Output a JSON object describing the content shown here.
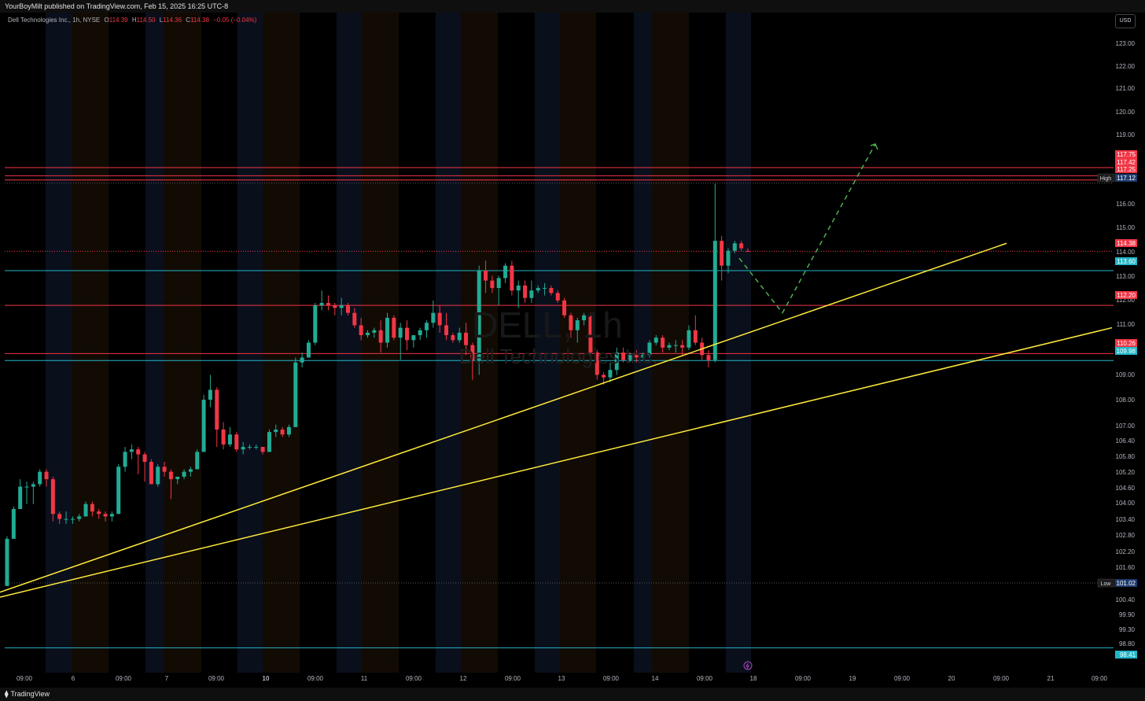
{
  "header": {
    "published": "YourBoyMilt published on TradingView.com, Feb 15, 2025 16:25 UTC-8"
  },
  "legend": {
    "symbol": "Dell Technologies Inc., 1h, NYSE",
    "o_label": "O",
    "o_value": "114.39",
    "h_label": "H",
    "h_value": "114.50",
    "l_label": "L",
    "l_value": "114.36",
    "c_label": "C",
    "c_value": "114.38",
    "change": "−0.05 (−0.04%)"
  },
  "currency": "USD",
  "watermark": {
    "ticker": "DELL, 1h",
    "name": "Dell Technologies Inc."
  },
  "footer": {
    "brand": "TradingView"
  },
  "colors": {
    "up": "#22ab94",
    "down": "#f23645",
    "trend": "#ffeb3b",
    "projection": "#4caf50",
    "resistance": "#f23645",
    "support": "#22b5c7"
  },
  "chart_data": {
    "type": "candlestick",
    "ylim": [
      97.9,
      123.5
    ],
    "y_ticks": [
      "123.00",
      "122.00",
      "121.00",
      "120.00",
      "119.00",
      "118.00",
      "116.00",
      "115.00",
      "114.00",
      "113.00",
      "112.00",
      "111.00",
      "109.00",
      "108.00",
      "107.00",
      "106.40",
      "105.80",
      "105.20",
      "104.60",
      "104.00",
      "103.40",
      "102.80",
      "102.20",
      "101.60",
      "100.40",
      "99.90",
      "99.30",
      "98.80"
    ],
    "x_ticks": [
      "09:00",
      "6",
      "09:00",
      "7",
      "09:00",
      "10",
      "09:00",
      "11",
      "09:00",
      "12",
      "09:00",
      "13",
      "09:00",
      "14",
      "09:00",
      "18",
      "09:00",
      "19",
      "09:00",
      "20",
      "09:00",
      "21",
      "09:00"
    ],
    "x_ticks_bold": [
      "10"
    ],
    "candles": [
      [
        100.9,
        102.9,
        100.9,
        102.8
      ],
      [
        102.8,
        104.1,
        102.8,
        104.0
      ],
      [
        104.0,
        105.2,
        104.0,
        104.9
      ],
      [
        104.9,
        105.1,
        104.2,
        104.9
      ],
      [
        104.9,
        105.1,
        104.2,
        105.0
      ],
      [
        105.0,
        105.6,
        104.9,
        105.5
      ],
      [
        105.5,
        105.6,
        104.9,
        105.2
      ],
      [
        105.2,
        105.3,
        103.5,
        103.8
      ],
      [
        103.8,
        103.9,
        103.4,
        103.6
      ],
      [
        103.6,
        103.9,
        103.4,
        103.6
      ],
      [
        103.6,
        103.7,
        103.4,
        103.6
      ],
      [
        103.6,
        103.8,
        103.5,
        103.7
      ],
      [
        103.7,
        104.3,
        103.7,
        104.2
      ],
      [
        104.2,
        104.3,
        103.7,
        103.9
      ],
      [
        103.9,
        104.0,
        103.6,
        103.8
      ],
      [
        103.8,
        103.9,
        103.5,
        103.7
      ],
      [
        103.7,
        103.9,
        103.5,
        103.8
      ],
      [
        103.8,
        105.8,
        103.8,
        105.7
      ],
      [
        105.7,
        106.5,
        105.5,
        106.3
      ],
      [
        106.3,
        106.6,
        106.0,
        106.4
      ],
      [
        106.4,
        106.5,
        105.4,
        106.2
      ],
      [
        106.2,
        106.3,
        105.1,
        105.9
      ],
      [
        105.9,
        106.0,
        105.0,
        105.0
      ],
      [
        105.0,
        105.8,
        104.9,
        105.7
      ],
      [
        105.7,
        105.9,
        105.3,
        105.5
      ],
      [
        105.5,
        105.6,
        104.4,
        105.2
      ],
      [
        105.2,
        105.3,
        105.0,
        105.3
      ],
      [
        105.3,
        105.6,
        105.2,
        105.5
      ],
      [
        105.5,
        105.7,
        105.3,
        105.6
      ],
      [
        105.6,
        106.4,
        105.6,
        106.3
      ],
      [
        106.3,
        108.6,
        106.3,
        108.4
      ],
      [
        108.4,
        109.4,
        108.1,
        108.8
      ],
      [
        108.8,
        108.9,
        106.5,
        107.2
      ],
      [
        107.2,
        107.5,
        106.4,
        106.6
      ],
      [
        106.6,
        107.3,
        106.5,
        107.0
      ],
      [
        107.0,
        107.1,
        106.3,
        106.4
      ],
      [
        106.4,
        106.7,
        106.2,
        106.5
      ],
      [
        106.5,
        106.6,
        106.4,
        106.5
      ],
      [
        106.5,
        106.6,
        106.4,
        106.5
      ],
      [
        106.5,
        106.5,
        106.2,
        106.3
      ],
      [
        106.3,
        107.2,
        106.3,
        107.1
      ],
      [
        107.1,
        107.4,
        106.9,
        107.2
      ],
      [
        107.2,
        107.3,
        106.9,
        107.0
      ],
      [
        107.0,
        107.4,
        106.9,
        107.3
      ],
      [
        107.3,
        110.1,
        107.3,
        109.9
      ],
      [
        109.9,
        110.3,
        109.7,
        110.1
      ],
      [
        110.1,
        110.8,
        110.1,
        110.7
      ],
      [
        110.7,
        112.3,
        110.6,
        112.2
      ],
      [
        112.2,
        112.8,
        112.0,
        112.3
      ],
      [
        112.3,
        112.6,
        112.0,
        112.2
      ],
      [
        112.2,
        112.3,
        111.8,
        112.1
      ],
      [
        112.1,
        112.5,
        111.8,
        112.2
      ],
      [
        112.2,
        112.3,
        111.8,
        111.9
      ],
      [
        111.9,
        112.1,
        111.3,
        111.4
      ],
      [
        111.4,
        111.7,
        110.8,
        111.0
      ],
      [
        111.0,
        111.2,
        110.9,
        111.1
      ],
      [
        111.1,
        111.3,
        110.9,
        111.2
      ],
      [
        111.2,
        111.6,
        110.3,
        110.7
      ],
      [
        110.7,
        111.9,
        110.5,
        111.7
      ],
      [
        111.7,
        111.8,
        110.8,
        110.9
      ],
      [
        110.9,
        111.5,
        110.0,
        111.3
      ],
      [
        111.3,
        111.6,
        110.4,
        110.8
      ],
      [
        110.8,
        111.0,
        110.5,
        111.0
      ],
      [
        111.0,
        111.3,
        110.8,
        111.2
      ],
      [
        111.2,
        111.6,
        110.9,
        111.5
      ],
      [
        111.5,
        112.4,
        111.3,
        111.9
      ],
      [
        111.9,
        112.2,
        111.1,
        111.4
      ],
      [
        111.4,
        111.9,
        110.8,
        111.0
      ],
      [
        111.0,
        111.1,
        110.7,
        110.8
      ],
      [
        110.8,
        111.3,
        110.7,
        111.1
      ],
      [
        111.1,
        111.5,
        110.2,
        110.6
      ],
      [
        110.6,
        110.7,
        109.2,
        110.0
      ],
      [
        110.0,
        113.8,
        109.4,
        113.6
      ],
      [
        113.6,
        114.0,
        112.7,
        113.2
      ],
      [
        113.2,
        113.4,
        112.7,
        112.9
      ],
      [
        112.9,
        113.4,
        112.2,
        113.3
      ],
      [
        113.3,
        113.9,
        113.1,
        113.8
      ],
      [
        113.8,
        114.0,
        112.6,
        112.8
      ],
      [
        112.8,
        113.2,
        112.1,
        113.0
      ],
      [
        113.0,
        113.2,
        112.3,
        112.5
      ],
      [
        112.5,
        113.2,
        112.3,
        112.8
      ],
      [
        112.8,
        113.0,
        112.7,
        112.9
      ],
      [
        112.9,
        113.1,
        112.6,
        112.9
      ],
      [
        112.9,
        113.0,
        112.6,
        112.7
      ],
      [
        112.7,
        112.8,
        112.3,
        112.4
      ],
      [
        112.4,
        112.5,
        111.7,
        111.8
      ],
      [
        111.8,
        111.9,
        110.9,
        111.2
      ],
      [
        111.2,
        111.7,
        110.7,
        111.6
      ],
      [
        111.6,
        111.9,
        111.4,
        111.8
      ],
      [
        111.8,
        111.9,
        110.1,
        110.3
      ],
      [
        110.3,
        110.4,
        109.2,
        109.4
      ],
      [
        109.4,
        109.5,
        109.0,
        109.3
      ],
      [
        109.3,
        109.9,
        109.1,
        109.6
      ],
      [
        109.6,
        110.5,
        109.4,
        110.3
      ],
      [
        110.3,
        110.5,
        109.9,
        110.0
      ],
      [
        110.0,
        110.3,
        109.9,
        110.2
      ],
      [
        110.2,
        110.4,
        109.9,
        110.1
      ],
      [
        110.1,
        110.3,
        110.0,
        110.2
      ],
      [
        110.2,
        110.8,
        110.1,
        110.7
      ],
      [
        110.7,
        111.0,
        110.6,
        110.9
      ],
      [
        110.9,
        111.0,
        110.3,
        110.5
      ],
      [
        110.5,
        110.7,
        110.4,
        110.6
      ],
      [
        110.6,
        110.8,
        110.3,
        110.6
      ],
      [
        110.6,
        110.8,
        110.2,
        110.5
      ],
      [
        110.5,
        111.4,
        110.4,
        111.2
      ],
      [
        111.2,
        111.8,
        110.6,
        110.7
      ],
      [
        110.7,
        110.9,
        110.0,
        110.2
      ],
      [
        110.2,
        110.4,
        109.7,
        110.0
      ],
      [
        110.0,
        117.1,
        109.9,
        114.8
      ],
      [
        114.8,
        115.0,
        113.2,
        113.8
      ],
      [
        113.8,
        114.5,
        113.5,
        114.4
      ],
      [
        114.4,
        114.8,
        114.3,
        114.7
      ],
      [
        114.7,
        114.8,
        114.4,
        114.5
      ],
      [
        114.39,
        114.5,
        114.36,
        114.38
      ]
    ],
    "levels": [
      {
        "label": "117.75",
        "value": 117.75,
        "kind": "resistance"
      },
      {
        "label": "117.42",
        "value": 117.42,
        "kind": "resistance"
      },
      {
        "label": "117.25",
        "value": 117.25,
        "kind": "resistance"
      },
      {
        "label": "117.12",
        "value": 117.12,
        "kind": "high",
        "tag": "High"
      },
      {
        "label": "114.38",
        "value": 114.38,
        "kind": "price"
      },
      {
        "label": "113.60",
        "value": 113.6,
        "kind": "support"
      },
      {
        "label": "112.20",
        "value": 112.2,
        "kind": "resistance"
      },
      {
        "label": "110.26",
        "value": 110.26,
        "kind": "resistance"
      },
      {
        "label": "109.98",
        "value": 109.98,
        "kind": "support"
      },
      {
        "label": "101.02",
        "value": 101.02,
        "kind": "low",
        "tag": "Low"
      },
      {
        "label": "98.41",
        "value": 98.41,
        "kind": "support"
      }
    ],
    "trendlines": [
      {
        "from": [
          0,
          100.65
        ],
        "to": [
          1280,
          114.7
        ]
      },
      {
        "from": [
          0,
          100.45
        ],
        "to": [
          1414,
          111.3
        ]
      }
    ],
    "projection": [
      [
        940,
        114.1
      ],
      [
        995,
        111.9
      ],
      [
        1113,
        118.7
      ]
    ]
  }
}
